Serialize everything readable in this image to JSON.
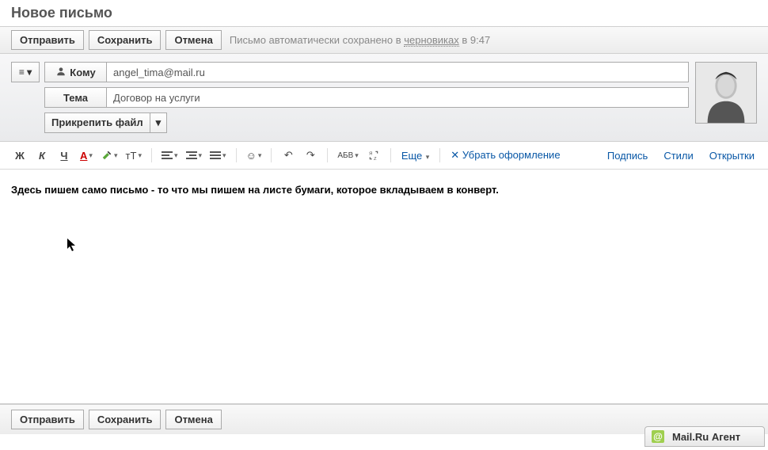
{
  "title": "Новое письмо",
  "topbar": {
    "send": "Отправить",
    "save": "Сохранить",
    "cancel": "Отмена",
    "autosave_prefix": "Письмо автоматически сохранено в ",
    "autosave_link": "черновиках",
    "autosave_time": " в 9:47"
  },
  "fields": {
    "to_label": "Кому",
    "to_value": "angel_tima@mail.ru",
    "subject_label": "Тема",
    "subject_value": "Договор на услуги",
    "attach": "Прикрепить файл"
  },
  "editor_toolbar": {
    "bold": "Ж",
    "italic": "К",
    "underline": "Ч",
    "color": "А",
    "font_size": "тТ",
    "abc": "АБВ",
    "more": "Еще",
    "remove_format": "Убрать оформление",
    "signature": "Подпись",
    "styles": "Стили",
    "postcards": "Открытки"
  },
  "body_text": "Здесь пишем само письмо - то что мы пишем на листе бумаги, которое вкладываем в конверт.",
  "bottombar": {
    "send": "Отправить",
    "save": "Сохранить",
    "cancel": "Отмена"
  },
  "agent": {
    "label": "Mail.Ru Агент",
    "icon": "@"
  }
}
